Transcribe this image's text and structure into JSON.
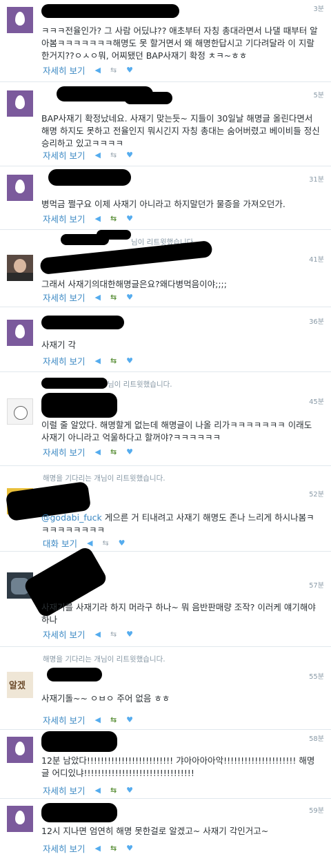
{
  "tweets": [
    {
      "time": "3분",
      "text": "ㅋㅋㅋ전율인가? 그 사람 어딨냐?? 애초부터 자칭 총대라면서 나댈 때부터 알아봄ㅋㅋㅋㅋㅋㅋㅋ해명도 못 할거면서 왜 해명한답시고 기다려달라 이 지랄한거지??ㅇㅅㅇ뭐, 어찌됐던 BAP사재기 확정 ㅊㅋ~ㅎㅎ",
      "more": "자세히 보기",
      "avatar": "egg"
    },
    {
      "time": "5분",
      "text": "BAP사재기 확정났네요. 사재기 맞는듯~ 지들이 30일날 해명글 올린다면서 해명 하지도 못하고 전율인지 뭐시긴지 자칭 총대는 숨어버렸고 베이비들 정신승리하고 있고ㅋㅋㅋㅋ",
      "more": "자세히 보기",
      "avatar": "egg"
    },
    {
      "time": "31분",
      "text": "병먹금 쩔구요 이제 사재기 아니라고 하지말던가 물증을 가져오던가.",
      "more": "자세히 보기",
      "avatar": "egg"
    },
    {
      "context": "님이 리트윗했습니다.",
      "time": "41분",
      "text": "그래서 사재기의대한해명글은요?왜다병먹음이야;;;;",
      "more": "자세히 보기",
      "avatar": "photo"
    },
    {
      "time": "36분",
      "text": "사재기 각",
      "more": "자세히 보기",
      "avatar": "egg"
    },
    {
      "context": "님이 리트윗했습니다.",
      "time": "45분",
      "text": "이럴 줄 알았다. 해명할게 없는데 해명글이 나올 리가ㅋㅋㅋㅋㅋㅋㅋ 이래도 사재기 아니라고 억울하다고 할꺼야?ㅋㅋㅋㅋㅋㅋ",
      "more": "자세히 보기",
      "avatar": "sketch"
    },
    {
      "context": "해명을 기다리는 개님이 리트윗했습니다.",
      "time": "52분",
      "mention": "@godabi_fuck",
      "text": " 게으른 거 티내려고 사재기 해명도 존나 느리게 하시나봄ㅋㅋㅋㅋㅋㅋㅋㅋㅋ",
      "more": "대화 보기",
      "avatar": "yellow"
    },
    {
      "time": "57분",
      "text": "사재기를 사재기라 하지 머라구 하나~ 뭐 음반판매량 조작? 이러케 얘기해야하나",
      "more": "자세히 보기",
      "avatar": "dark"
    },
    {
      "context": "해명을 기다리는 개님이 리트윗했습니다.",
      "time": "55분",
      "text": "사재기돌~~ ㅇㅂㅇ 주어 없음 ㅎㅎ",
      "more": "자세히 보기",
      "avatar": "callig"
    },
    {
      "time": "58분",
      "text": "12분 남았다!!!!!!!!!!!!!!!!!!!!!!!!! 갸아아아아악!!!!!!!!!!!!!!!!!!!!! 해명글 어디있냐!!!!!!!!!!!!!!!!!!!!!!!!!!!!!!!!",
      "more": "자세히 보기",
      "avatar": "egg"
    },
    {
      "time": "59분",
      "text": "12시 지나면 엄연히 해명 못한걸로 알겠고~ 사재기 각인거고~",
      "more": "자세히 보기",
      "avatar": "egg"
    }
  ],
  "icons": {
    "reply": "reply-icon",
    "retweet": "retweet-icon",
    "favorite": "heart-icon"
  },
  "colors": {
    "accent": "#3b88c3",
    "egg_bg": "#7b5a9c",
    "meta": "#8899a6"
  }
}
